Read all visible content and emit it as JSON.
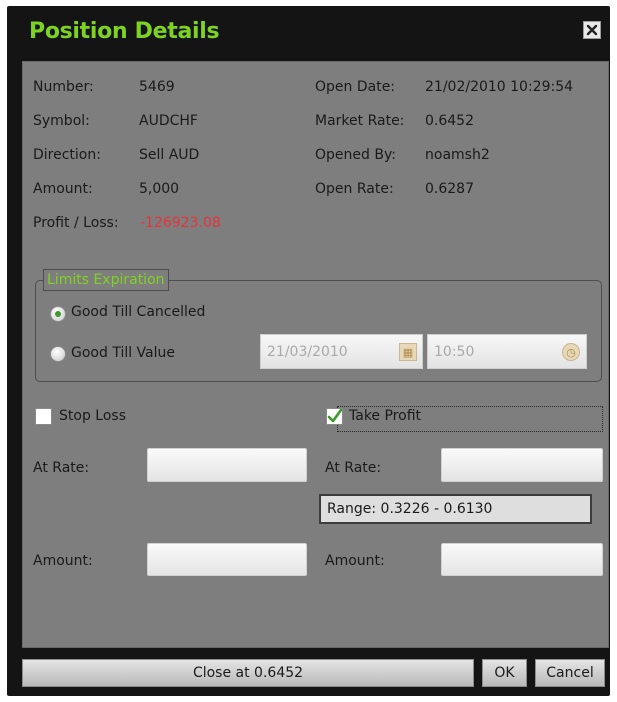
{
  "window": {
    "title": "Position Details"
  },
  "details": {
    "number_label": "Number:",
    "number_value": "5469",
    "symbol_label": "Symbol:",
    "symbol_value": "AUDCHF",
    "direction_label": "Direction:",
    "direction_value": "Sell AUD",
    "amount_label": "Amount:",
    "amount_value": "5,000",
    "profit_loss_label": "Profit / Loss:",
    "profit_loss_value": "-126923.08",
    "open_date_label": "Open Date:",
    "open_date_value": "21/02/2010 10:29:54",
    "market_rate_label": "Market Rate:",
    "market_rate_value": "0.6452",
    "opened_by_label": "Opened By:",
    "opened_by_value": "noamsh2",
    "open_rate_label": "Open Rate:",
    "open_rate_value": "0.6287"
  },
  "limits": {
    "legend": "Limits Expiration",
    "good_till_cancelled": "Good Till Cancelled",
    "good_till_value": "Good Till Value",
    "selected": "good_till_cancelled",
    "date_value": "21/03/2010",
    "time_value": "10:50"
  },
  "stop_loss": {
    "label": "Stop Loss",
    "checked": false,
    "at_rate_label": "At Rate:",
    "at_rate_value": "",
    "amount_label": "Amount:",
    "amount_value": ""
  },
  "take_profit": {
    "label": "Take Profit",
    "checked": true,
    "at_rate_label": "At Rate:",
    "at_rate_value": "",
    "range_text": "Range: 0.3226 - 0.6130",
    "amount_label": "Amount:",
    "amount_value": ""
  },
  "footer": {
    "close_at_label": "Close at 0.6452",
    "ok_label": "OK",
    "cancel_label": "Cancel"
  },
  "colors": {
    "accent": "#7ed321",
    "loss": "#e8323a",
    "panel": "#7e7e7e",
    "frame": "#141414"
  }
}
